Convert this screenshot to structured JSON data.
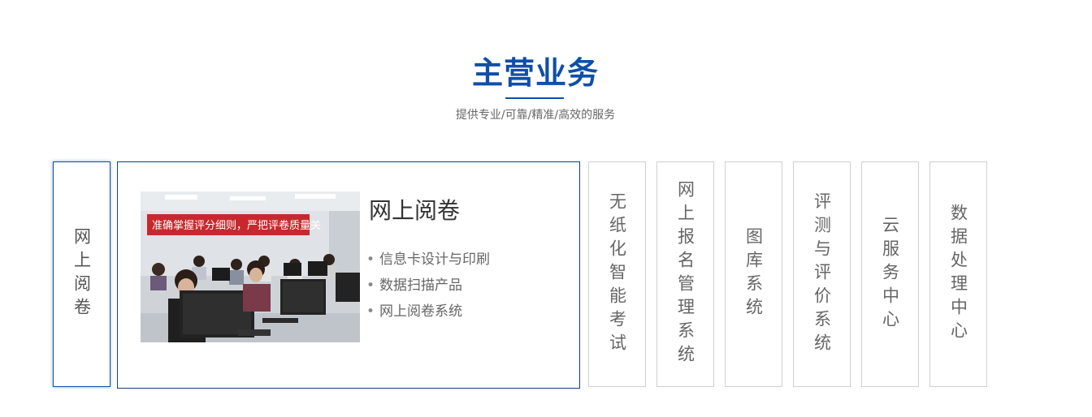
{
  "section": {
    "title": "主营业务",
    "subtitle": "提供专业/可靠/精准/高效的服务"
  },
  "tabs": [
    {
      "label": "网上阅卷",
      "active": true
    },
    {
      "label": "无纸化智能考试",
      "active": false
    },
    {
      "label": "网上报名管理系统",
      "active": false
    },
    {
      "label": "图库系统",
      "active": false
    },
    {
      "label": "评测与评价系统",
      "active": false
    },
    {
      "label": "云服务中心",
      "active": false
    },
    {
      "label": "数据处理中心",
      "active": false
    }
  ],
  "panel": {
    "heading": "网上阅卷",
    "banner_text": "准确掌握评分细则，严把评卷质量关",
    "items": [
      "信息卡设计与印刷",
      "数据扫描产品",
      "网上阅卷系统"
    ]
  },
  "colors": {
    "accent": "#0f4fa8",
    "panel_border": "#0f3f80",
    "tab_border": "#d0d0d0",
    "text_muted": "#666666",
    "banner_red": "#c8282d"
  }
}
